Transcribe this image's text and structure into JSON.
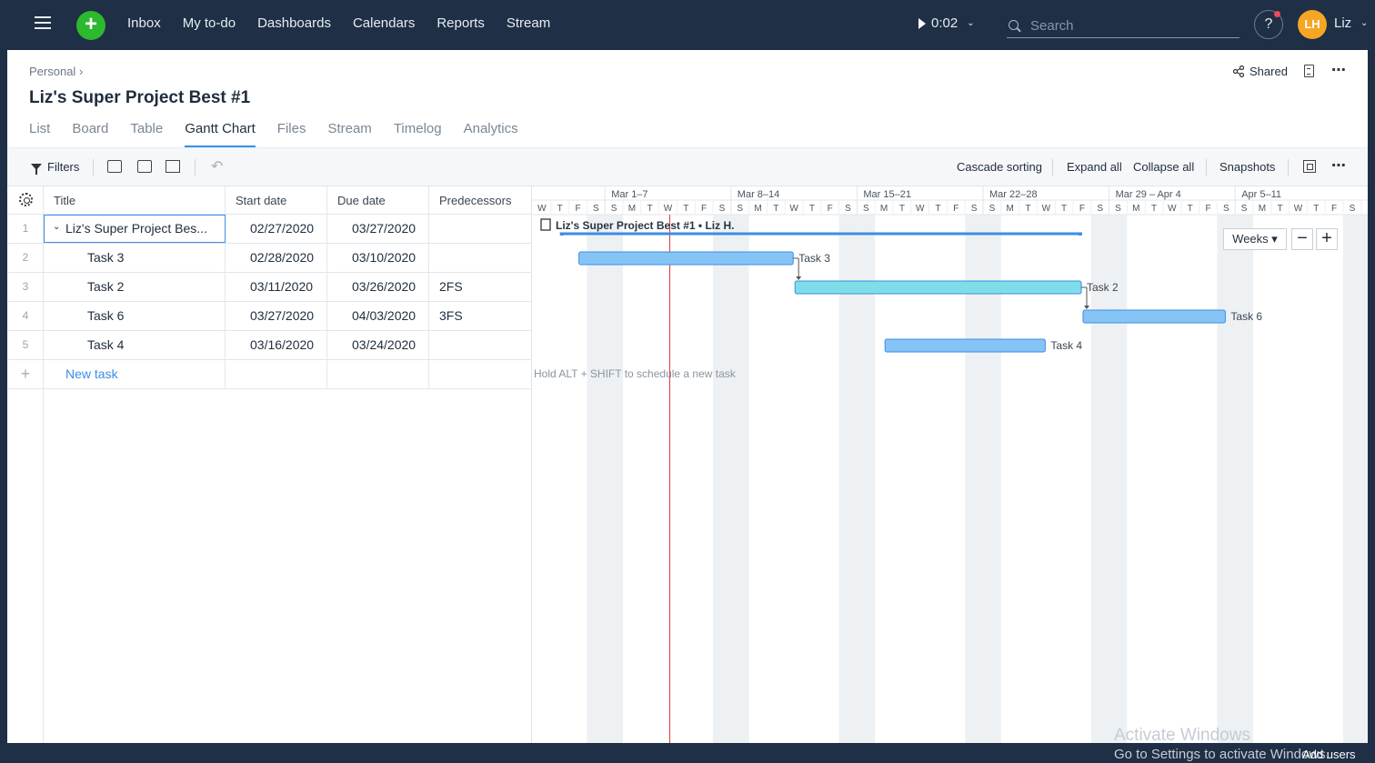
{
  "topbar": {
    "nav": [
      "Inbox",
      "My to-do",
      "Dashboards",
      "Calendars",
      "Reports",
      "Stream"
    ],
    "timer": "0:02",
    "search_placeholder": "Search",
    "help": "?",
    "avatar_initials": "LH",
    "username": "Liz"
  },
  "header": {
    "breadcrumb": "Personal",
    "title": "Liz's Super Project Best #1",
    "shared": "Shared",
    "tabs": [
      "List",
      "Board",
      "Table",
      "Gantt Chart",
      "Files",
      "Stream",
      "Timelog",
      "Analytics"
    ],
    "active_tab": "Gantt Chart"
  },
  "toolbar": {
    "filters": "Filters",
    "cascade_sorting": "Cascade sorting",
    "expand_all": "Expand all",
    "collapse_all": "Collapse all",
    "snapshots": "Snapshots"
  },
  "grid": {
    "columns": [
      "Title",
      "Start date",
      "Due date",
      "Predecessors"
    ],
    "rows": [
      {
        "num": "1",
        "title": "Liz's Super Project Bes...",
        "start": "02/27/2020",
        "due": "03/27/2020",
        "pred": ""
      },
      {
        "num": "2",
        "title": "Task 3",
        "start": "02/28/2020",
        "due": "03/10/2020",
        "pred": ""
      },
      {
        "num": "3",
        "title": "Task 2",
        "start": "03/11/2020",
        "due": "03/26/2020",
        "pred": "2FS"
      },
      {
        "num": "4",
        "title": "Task 6",
        "start": "03/27/2020",
        "due": "04/03/2020",
        "pred": "3FS"
      },
      {
        "num": "5",
        "title": "Task 4",
        "start": "03/16/2020",
        "due": "03/24/2020",
        "pred": ""
      }
    ],
    "new_task": "New task"
  },
  "gantt": {
    "weeks": [
      "Mar 1–7",
      "Mar 8–14",
      "Mar 15–21",
      "Mar 22–28",
      "Mar 29 – Apr 4",
      "Apr 5–11"
    ],
    "first_day": "W",
    "day_letters": [
      "S",
      "M",
      "T",
      "W",
      "T",
      "F",
      "S"
    ],
    "project_label": "Liz's Super Project Best #1 • Liz H.",
    "hint": "Hold ALT + SHIFT to schedule a new task",
    "scale": "Weeks",
    "bars": [
      {
        "label": "Task 3",
        "start": "02/28/2020",
        "end": "03/10/2020",
        "color": "#86c4f5"
      },
      {
        "label": "Task 2",
        "start": "03/11/2020",
        "end": "03/26/2020",
        "color": "#7fdde8"
      },
      {
        "label": "Task 6",
        "start": "03/27/2020",
        "end": "04/03/2020",
        "color": "#86c4f5"
      },
      {
        "label": "Task 4",
        "start": "03/16/2020",
        "end": "03/24/2020",
        "color": "#86c4f5"
      }
    ],
    "today": "03/04/2020"
  },
  "watermark": {
    "title": "Activate Windows",
    "sub": "Go to Settings to activate Windows."
  },
  "add_users": "Add users",
  "colors": {
    "topbar": "#1f2f45",
    "accent": "#3a8ee6",
    "plus": "#2db82d",
    "avatar": "#f5a623",
    "today_line": "#e0393e"
  }
}
